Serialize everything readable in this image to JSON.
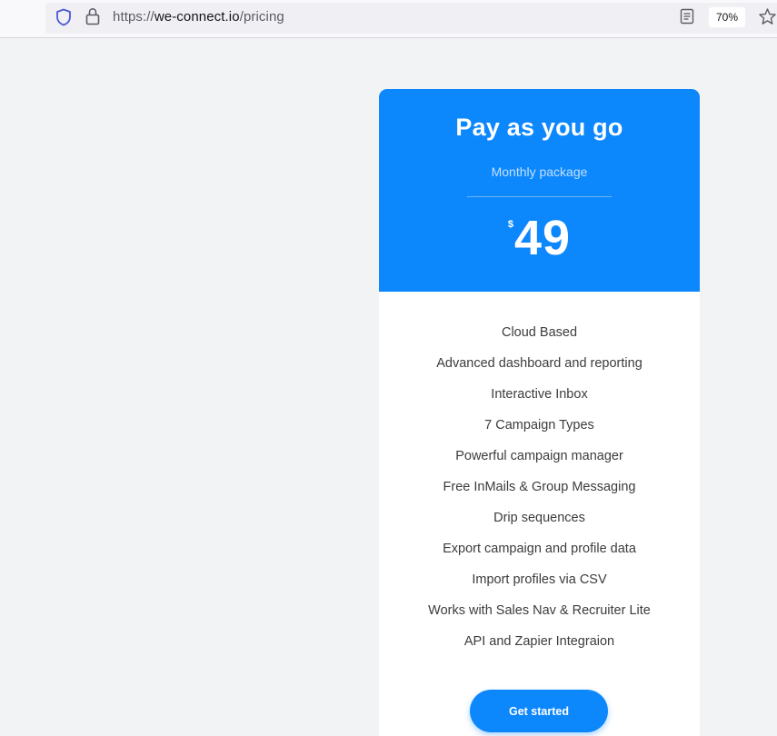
{
  "browser": {
    "url_scheme": "https://",
    "url_domain": "we-connect.io",
    "url_path": "/pricing",
    "zoom": "70%",
    "icons": [
      "shield-icon",
      "lock-icon",
      "reader-view-icon",
      "bookmark-star-icon"
    ]
  },
  "plan": {
    "title": "Pay as you go",
    "subtitle": "Monthly package",
    "currency_symbol": "$",
    "price": "49",
    "features": [
      "Cloud Based",
      "Advanced dashboard and reporting",
      "Interactive Inbox",
      "7 Campaign Types",
      "Powerful campaign manager",
      "Free InMails & Group Messaging",
      "Drip sequences",
      "Export campaign and profile data",
      "Import profiles via CSV",
      "Works with Sales Nav & Recruiter Lite",
      "API and Zapier Integraion"
    ],
    "cta_label": "Get started"
  },
  "colors": {
    "accent": "#0d87fc",
    "page_background": "#f2f3f5",
    "feature_text": "#3c3c3c"
  }
}
